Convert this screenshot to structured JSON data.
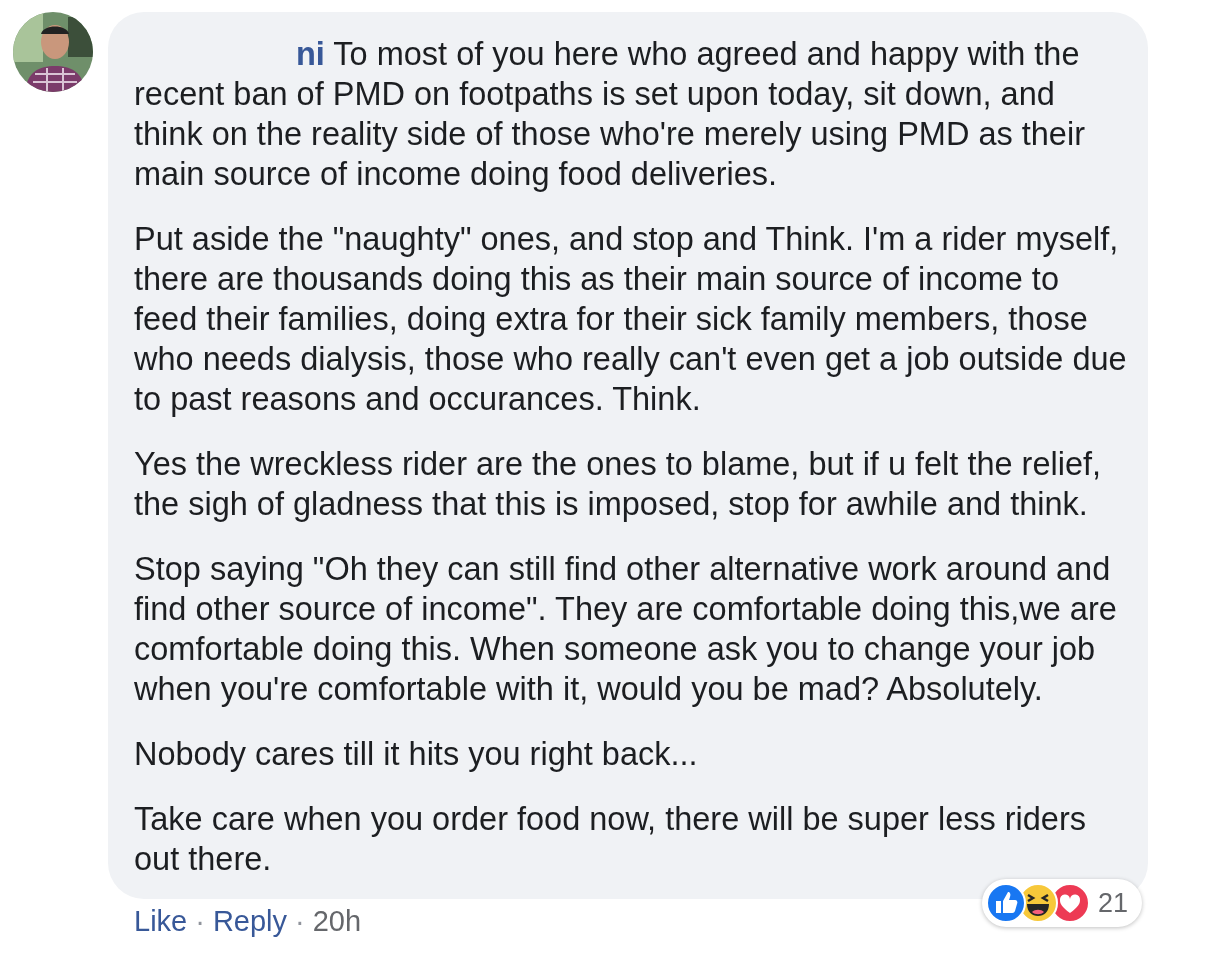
{
  "comment": {
    "author": "ni",
    "paragraphs": [
      "To most of you here who agreed and happy with the recent ban of PMD on footpaths is set upon today, sit down, and think on the reality side of those who're merely using PMD as their main source of income doing food deliveries.",
      "Put aside the \"naughty\" ones, and stop and Think. I'm a rider myself, there are thousands doing this as their main source of income to feed their families, doing extra for their sick family members, those who needs dialysis, those who really can't even get a job outside due to past reasons and occurances. Think.",
      "Yes the wreckless rider are the ones to blame, but if u felt the relief, the sigh of gladness that this is imposed, stop for awhile and think.",
      "Stop saying \"Oh they can still find other alternative work around and find other source of income\". They are comfortable doing this,we are comfortable doing this. When someone ask you to change your job when you're comfortable with it, would you be mad? Absolutely.",
      "Nobody cares till it hits you right back...",
      "Take care when you order food now, there will be super less riders out there."
    ],
    "reactions": {
      "icons": [
        {
          "kind": "like"
        },
        {
          "kind": "haha"
        },
        {
          "kind": "love"
        }
      ],
      "count": "21"
    },
    "separator": "·",
    "actions": [
      {
        "label": "Like"
      },
      {
        "label": "Reply"
      }
    ],
    "time": "20h"
  }
}
